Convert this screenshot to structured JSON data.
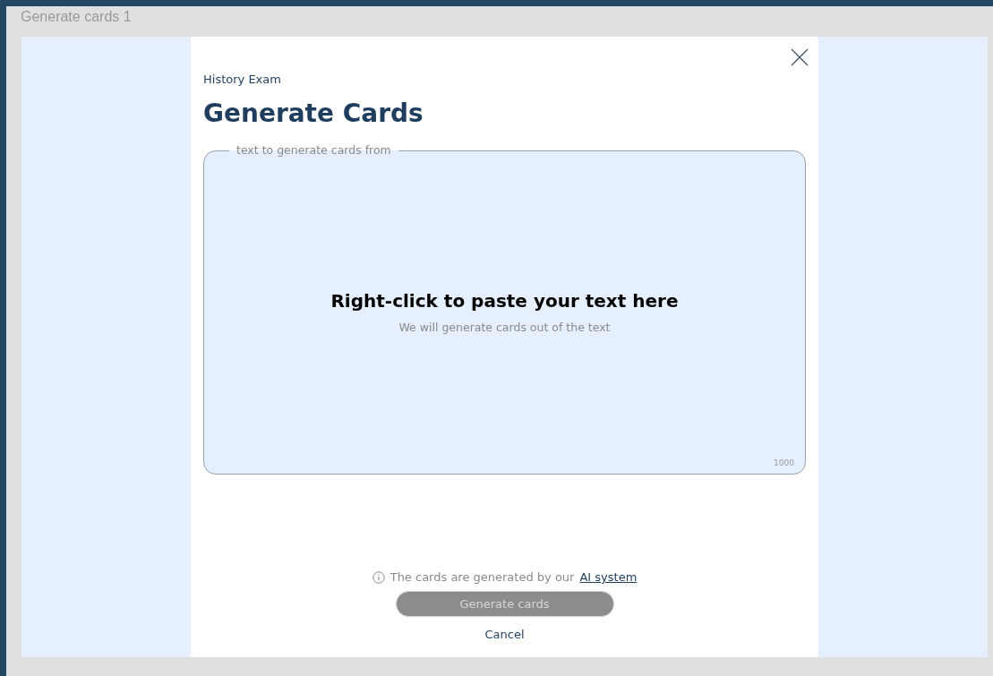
{
  "frame": {
    "title": "Generate cards 1"
  },
  "modal": {
    "breadcrumb": "History Exam",
    "title": "Generate Cards",
    "text_field": {
      "legend": "text to generate cards from",
      "prompt_title": "Right-click to paste your text here",
      "prompt_subtitle": "We will generate cards out of the text",
      "counter": "1000"
    },
    "notice": {
      "text": "The cards are generated by our",
      "link": "AI system"
    },
    "generate_button": {
      "label": "Generate cards",
      "disabled": true
    },
    "cancel_button": {
      "label": "Cancel"
    }
  }
}
